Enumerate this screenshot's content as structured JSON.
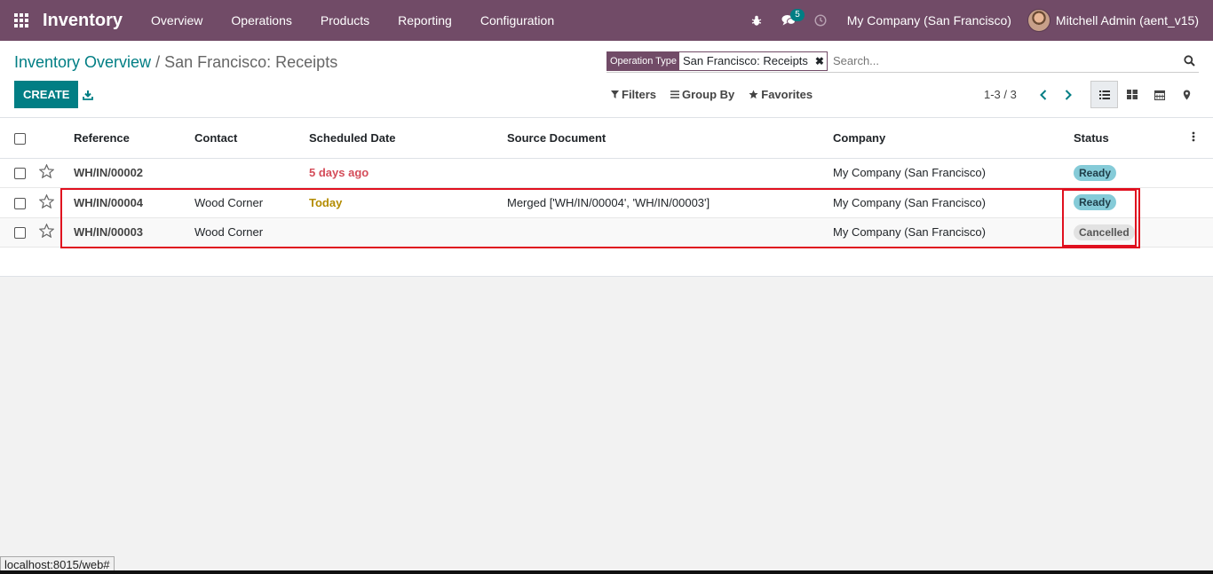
{
  "navbar": {
    "app_name": "Inventory",
    "menu": [
      "Overview",
      "Operations",
      "Products",
      "Reporting",
      "Configuration"
    ],
    "message_count": "5",
    "company": "My Company (San Francisco)",
    "user": "Mitchell Admin (aent_v15)"
  },
  "breadcrumb": {
    "parent": "Inventory Overview",
    "separator": "/",
    "current": "San Francisco: Receipts"
  },
  "search": {
    "facet_category": "Operation Type",
    "facet_value": "San Francisco: Receipts",
    "placeholder": "Search..."
  },
  "buttons": {
    "create": "CREATE"
  },
  "search_options": {
    "filters": "Filters",
    "group_by": "Group By",
    "favorites": "Favorites"
  },
  "pager": {
    "value": "1-3 / 3"
  },
  "table": {
    "columns": [
      "Reference",
      "Contact",
      "Scheduled Date",
      "Source Document",
      "Company",
      "Status"
    ],
    "rows": [
      {
        "reference": "WH/IN/00002",
        "contact": "",
        "scheduled_date": "5 days ago",
        "source_document": "",
        "company": "My Company (San Francisco)",
        "status": "Ready"
      },
      {
        "reference": "WH/IN/00004",
        "contact": "Wood Corner",
        "scheduled_date": "Today",
        "source_document": "Merged ['WH/IN/00004', 'WH/IN/00003']",
        "company": "My Company (San Francisco)",
        "status": "Ready"
      },
      {
        "reference": "WH/IN/00003",
        "contact": "Wood Corner",
        "scheduled_date": "",
        "source_document": "",
        "company": "My Company (San Francisco)",
        "status": "Cancelled"
      }
    ]
  },
  "browser_status": "localhost:8015/web#",
  "colors": {
    "navbar": "#714b67",
    "primary": "#017e84",
    "late": "#d44c59",
    "today": "#b38c00",
    "highlight": "#e0101f"
  }
}
